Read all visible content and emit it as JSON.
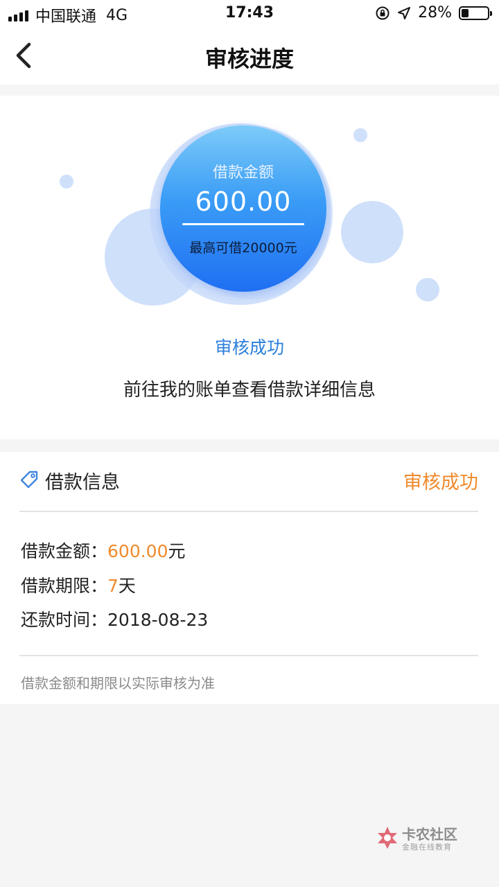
{
  "status_bar": {
    "carrier": "中国联通",
    "network": "4G",
    "time": "17:43",
    "battery": "28%",
    "battery_level": 0.28
  },
  "nav": {
    "back_icon": "chevron-left-icon",
    "title": "审核进度"
  },
  "hero": {
    "circle_label": "借款金额",
    "amount": "600.00",
    "max_text": "最高可借20000元",
    "status": "审核成功",
    "description": "前往我的账单查看借款详细信息"
  },
  "info": {
    "icon": "tag-icon",
    "title": "借款信息",
    "status": "审核成功",
    "rows": [
      {
        "label": "借款金额：",
        "value": "600.00",
        "suffix": "元"
      },
      {
        "label": "借款期限：",
        "value": "7",
        "suffix": "天"
      },
      {
        "label": "还款时间：",
        "value": "2018-08-23",
        "suffix": ""
      }
    ],
    "note": "借款金额和期限以实际审核为准"
  },
  "watermark": {
    "title": "卡农社区",
    "subtitle": "金融在线教育"
  },
  "colors": {
    "accent_blue": "#2a7fdc",
    "accent_orange": "#f08a2c",
    "circle_gradient_top": "#7dcbf8",
    "circle_gradient_bottom": "#1f6ff2"
  }
}
